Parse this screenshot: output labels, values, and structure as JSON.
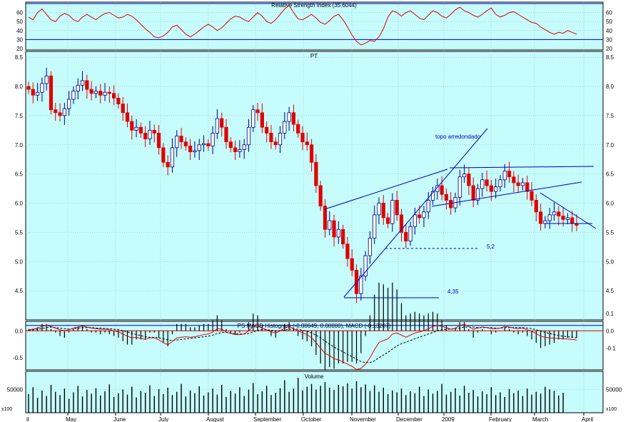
{
  "colors": {
    "background": "#c6fcfc",
    "grid": "#9ab8c4",
    "border": "#000000",
    "up_candle_fill": "#ffffff",
    "up_candle_stroke": "#000080",
    "down_candle": "#e00000",
    "rsi_line": "#e00000",
    "rsi_levels": "#0000c0",
    "trendlines": "#0000c0",
    "macd_signal": "#000000",
    "macd_line": "#e00000",
    "histogram": "#000000",
    "volume": "#000000",
    "annotation_text": "#0000c0"
  },
  "labels": {
    "x_left_fragment": "il",
    "months": [
      "May",
      "June",
      "July",
      "August",
      "September",
      "October",
      "November",
      "December",
      "2009",
      "February",
      "March",
      "April"
    ],
    "volume_scale_left": "x100",
    "volume_scale_right": "x100"
  },
  "chart_data": [
    {
      "type": "line",
      "title": "Relative Strength Index (35.6044)",
      "ylim": [
        20,
        70
      ],
      "yticks": [
        20,
        30,
        40,
        50,
        60
      ],
      "levels": [
        30,
        70
      ],
      "series": [
        {
          "values": [
            55,
            52,
            60,
            64,
            58,
            52,
            50,
            56,
            59,
            57,
            52,
            50,
            55,
            58,
            55,
            52,
            56,
            59,
            60,
            57,
            54,
            55,
            58,
            56,
            52,
            47,
            42,
            38,
            33,
            32,
            34,
            38,
            44,
            46,
            41,
            36,
            33,
            36,
            40,
            44,
            47,
            44,
            40,
            43,
            48,
            53,
            56,
            55,
            52,
            50,
            55,
            60,
            56,
            50,
            48,
            52,
            58,
            64,
            68,
            60,
            53,
            52,
            55,
            58,
            54,
            49,
            47,
            51,
            56,
            58,
            52,
            44,
            35,
            28,
            24,
            26,
            29,
            28,
            33,
            42,
            55,
            62,
            60,
            56,
            60,
            62,
            58,
            54,
            52,
            57,
            62,
            60,
            56,
            54,
            58,
            63,
            66,
            62,
            60,
            57,
            55,
            58,
            62,
            65,
            58,
            55,
            57,
            60,
            61,
            58,
            55,
            52,
            49,
            48,
            44,
            41,
            38,
            36,
            38,
            37,
            40,
            38,
            36
          ]
        }
      ]
    },
    {
      "type": "candlestick",
      "title": "PT",
      "ylim": [
        4.0,
        8.6
      ],
      "yticks": [
        4.5,
        5.0,
        5.5,
        6.0,
        6.5,
        7.0,
        7.5,
        8.0,
        8.5
      ],
      "close": [
        7.95,
        7.85,
        7.9,
        8.05,
        8.18,
        7.6,
        7.55,
        7.5,
        7.62,
        7.78,
        7.92,
        8.02,
        8.1,
        7.95,
        7.88,
        7.92,
        7.85,
        7.9,
        7.88,
        7.8,
        7.7,
        7.55,
        7.4,
        7.25,
        7.3,
        7.2,
        7.1,
        7.25,
        7.2,
        6.95,
        6.7,
        6.62,
        6.95,
        7.15,
        7.05,
        6.98,
        6.88,
        6.9,
        7.0,
        7.02,
        6.98,
        7.2,
        7.45,
        7.3,
        7.05,
        6.95,
        6.88,
        6.92,
        7.0,
        7.3,
        7.6,
        7.55,
        7.3,
        7.2,
        7.05,
        7.0,
        7.2,
        7.4,
        7.55,
        7.35,
        7.2,
        7.05,
        7.0,
        6.7,
        6.3,
        5.95,
        5.55,
        5.7,
        5.42,
        5.55,
        5.3,
        5.05,
        4.85,
        4.45,
        4.75,
        5.1,
        5.4,
        5.8,
        6.0,
        5.75,
        5.65,
        6.05,
        5.8,
        5.5,
        5.35,
        5.6,
        5.8,
        5.75,
        5.85,
        6.05,
        6.2,
        6.3,
        6.15,
        6.05,
        5.92,
        6.1,
        6.45,
        6.5,
        6.3,
        6.05,
        6.25,
        6.4,
        6.3,
        6.2,
        6.28,
        6.4,
        6.55,
        6.45,
        6.35,
        6.3,
        6.35,
        6.2,
        6.05,
        5.85,
        5.65,
        5.7,
        5.8,
        5.85,
        5.78,
        5.72,
        5.75,
        5.65,
        5.62
      ],
      "annotations": {
        "texts": [
          "topo arredondado",
          "5,2",
          "4,35"
        ],
        "support_level_1": 5.2,
        "support_level_2": 4.35
      }
    },
    {
      "type": "line",
      "title": "PS MACD Histogram (-0.00649, 0.00000), MACD (-0.13207)",
      "ylim": [
        -0.7,
        0.15
      ],
      "yticks_left": [
        -0.5,
        0.0
      ],
      "yticks_right": [
        -0.1,
        0.0,
        0.1
      ],
      "series": [
        {
          "values": [
            0.02,
            0.03,
            0.05,
            0.08,
            0.1,
            0.08,
            0.05,
            0.02,
            0.0,
            0.02,
            0.05,
            0.07,
            0.09,
            0.07,
            0.05,
            0.04,
            0.03,
            0.03,
            0.02,
            0.0,
            -0.02,
            -0.06,
            -0.1,
            -0.13,
            -0.12,
            -0.14,
            -0.16,
            -0.13,
            -0.13,
            -0.17,
            -0.22,
            -0.26,
            -0.2,
            -0.13,
            -0.12,
            -0.11,
            -0.12,
            -0.11,
            -0.09,
            -0.07,
            -0.06,
            -0.02,
            0.04,
            0.03,
            -0.02,
            -0.05,
            -0.07,
            -0.07,
            -0.06,
            0.0,
            0.08,
            0.1,
            0.05,
            0.02,
            -0.02,
            -0.04,
            0.0,
            0.05,
            0.08,
            0.04,
            0.0,
            -0.04,
            -0.07,
            -0.13,
            -0.22,
            -0.32,
            -0.42,
            -0.46,
            -0.52,
            -0.54,
            -0.58,
            -0.62,
            -0.66,
            -0.72,
            -0.7,
            -0.62,
            -0.5,
            -0.35,
            -0.22,
            -0.18,
            -0.15,
            -0.06,
            -0.04,
            -0.08,
            -0.12,
            -0.08,
            -0.04,
            -0.02,
            0.0,
            0.04,
            0.08,
            0.1,
            0.08,
            0.06,
            0.03,
            0.05,
            0.1,
            0.12,
            0.08,
            0.03,
            0.05,
            0.07,
            0.06,
            0.04,
            0.04,
            0.05,
            0.08,
            0.07,
            0.05,
            0.04,
            0.05,
            0.02,
            -0.01,
            -0.05,
            -0.1,
            -0.12,
            -0.13,
            -0.14,
            -0.14,
            -0.15,
            -0.15,
            -0.16,
            -0.17
          ]
        },
        {
          "values": [
            0.01,
            0.02,
            0.03,
            0.04,
            0.06,
            0.07,
            0.06,
            0.05,
            0.04,
            0.03,
            0.04,
            0.05,
            0.06,
            0.06,
            0.06,
            0.05,
            0.05,
            0.04,
            0.04,
            0.03,
            0.02,
            0.0,
            -0.02,
            -0.05,
            -0.07,
            -0.09,
            -0.11,
            -0.12,
            -0.12,
            -0.13,
            -0.15,
            -0.17,
            -0.18,
            -0.17,
            -0.16,
            -0.15,
            -0.14,
            -0.13,
            -0.12,
            -0.11,
            -0.1,
            -0.08,
            -0.05,
            -0.03,
            -0.03,
            -0.04,
            -0.05,
            -0.06,
            -0.06,
            -0.05,
            -0.02,
            0.01,
            0.02,
            0.02,
            0.01,
            0.0,
            0.0,
            0.01,
            0.03,
            0.03,
            0.03,
            0.01,
            -0.01,
            -0.04,
            -0.08,
            -0.13,
            -0.19,
            -0.25,
            -0.3,
            -0.35,
            -0.39,
            -0.44,
            -0.48,
            -0.53,
            -0.57,
            -0.59,
            -0.59,
            -0.56,
            -0.5,
            -0.45,
            -0.4,
            -0.34,
            -0.28,
            -0.24,
            -0.21,
            -0.18,
            -0.15,
            -0.12,
            -0.09,
            -0.06,
            -0.03,
            0.0,
            0.02,
            0.03,
            0.03,
            0.04,
            0.05,
            0.07,
            0.07,
            0.07,
            0.06,
            0.06,
            0.06,
            0.06,
            0.05,
            0.05,
            0.06,
            0.06,
            0.06,
            0.06,
            0.06,
            0.05,
            0.04,
            0.02,
            0.0,
            -0.03,
            -0.05,
            -0.07,
            -0.09,
            -0.1,
            -0.11,
            -0.12,
            -0.13
          ]
        }
      ],
      "histogram": [
        0.01,
        0.01,
        0.02,
        0.04,
        0.04,
        0.01,
        -0.01,
        -0.03,
        -0.04,
        -0.01,
        0.01,
        0.02,
        0.03,
        0.01,
        -0.01,
        -0.01,
        -0.02,
        -0.01,
        -0.02,
        -0.03,
        -0.04,
        -0.06,
        -0.08,
        -0.08,
        -0.05,
        -0.05,
        -0.05,
        -0.01,
        -0.01,
        -0.04,
        -0.07,
        -0.09,
        -0.02,
        0.04,
        0.04,
        0.04,
        0.02,
        0.02,
        0.03,
        0.04,
        0.04,
        0.06,
        0.09,
        0.06,
        0.01,
        -0.01,
        -0.02,
        -0.01,
        0.0,
        0.05,
        0.1,
        0.09,
        0.03,
        0.0,
        -0.03,
        -0.04,
        0.0,
        0.04,
        0.05,
        0.01,
        -0.03,
        -0.05,
        -0.06,
        -0.09,
        -0.14,
        -0.19,
        -0.23,
        -0.21,
        -0.22,
        -0.19,
        -0.19,
        -0.18,
        -0.18,
        -0.19,
        -0.13,
        -0.03,
        0.09,
        0.21,
        0.28,
        0.27,
        0.25,
        0.28,
        0.24,
        0.16,
        0.09,
        0.1,
        0.11,
        0.1,
        0.09,
        0.1,
        0.11,
        0.1,
        0.06,
        0.03,
        0.0,
        0.01,
        0.05,
        0.05,
        0.01,
        -0.04,
        -0.01,
        0.01,
        0.0,
        -0.02,
        -0.01,
        0.0,
        0.02,
        0.01,
        -0.01,
        -0.02,
        -0.01,
        -0.03,
        -0.05,
        -0.07,
        -0.1,
        -0.09,
        -0.08,
        -0.07,
        -0.05,
        -0.05,
        -0.04,
        -0.04,
        -0.04
      ]
    },
    {
      "type": "bar",
      "title": "Volume",
      "yticks": [
        50000
      ],
      "ylim": [
        0,
        80000
      ],
      "values": [
        40000,
        55000,
        32000,
        48000,
        36000,
        60000,
        45000,
        38000,
        52000,
        30000,
        44000,
        58000,
        35000,
        49000,
        41000,
        53000,
        37000,
        46000,
        61000,
        34000,
        42000,
        50000,
        39000,
        56000,
        33000,
        47000,
        43000,
        59000,
        36000,
        51000,
        40000,
        54000,
        38000,
        45000,
        62000,
        35000,
        48000,
        42000,
        57000,
        37000,
        44000,
        52000,
        39000,
        60000,
        34000,
        47000,
        41000,
        55000,
        36000,
        50000,
        64000,
        40000,
        46000,
        58000,
        38000,
        43000,
        53000,
        70000,
        45000,
        52000,
        75000,
        48000,
        56000,
        62000,
        50000,
        58000,
        66000,
        54000,
        49000,
        60000,
        57000,
        63000,
        52000,
        68000,
        55000,
        61000,
        47000,
        59000,
        45000,
        54000,
        40000,
        48000,
        44000,
        52000,
        38000,
        46000,
        42000,
        56000,
        36000,
        50000,
        41000,
        47000,
        62000,
        39000,
        45000,
        53000,
        37000,
        58000,
        43000,
        49000,
        35000,
        46000,
        40000,
        55000,
        38000,
        44000,
        34000,
        51000,
        42000,
        48000,
        36000,
        52000,
        39000,
        45000,
        41000,
        56000,
        50000,
        47000,
        37000,
        43000
      ]
    }
  ]
}
